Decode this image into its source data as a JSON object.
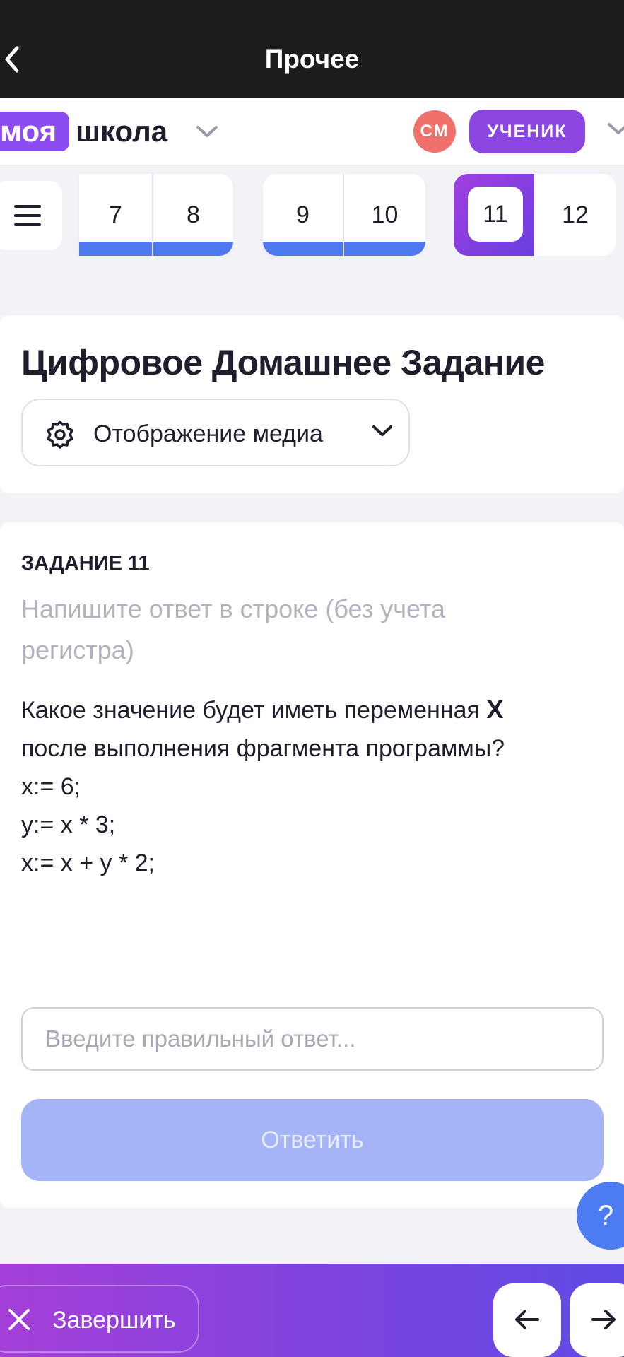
{
  "topbar": {
    "title": "Прочее",
    "back_icon": "chevron-left-icon"
  },
  "header": {
    "logo_part1": "моя",
    "logo_part2": "школа",
    "avatar_initials": "СМ",
    "role": "УЧЕНИК"
  },
  "lessons": {
    "groups": [
      {
        "items": [
          "7",
          "8"
        ],
        "status": "done"
      },
      {
        "items": [
          "9",
          "10"
        ],
        "status": "done"
      }
    ],
    "current": "11",
    "next": "12"
  },
  "page": {
    "title": "Цифровое Домашнее Задание",
    "media_select_label": "Отображение медиа"
  },
  "task": {
    "number_label": "ЗАДАНИЕ 11",
    "hint": "Напишите ответ в строке (без учета регистра)",
    "question_prefix": "Какое значение будет иметь переменная ",
    "question_var": "X",
    "question_suffix": "после выполнения фрагмента программы?",
    "code": [
      "x:= 6;",
      "y:= x * 3;",
      "x:= x + y * 2;"
    ],
    "answer_placeholder": "Введите правильный ответ...",
    "answer_value": "",
    "submit_label": "Ответить"
  },
  "help": {
    "label": "?"
  },
  "bottom": {
    "finish_label": "Завершить"
  },
  "colors": {
    "accent_blue": "#4d78ee",
    "accent_purple": "#8b45e0",
    "button_disabled": "#a4b4f7",
    "avatar": "#f0716b"
  }
}
